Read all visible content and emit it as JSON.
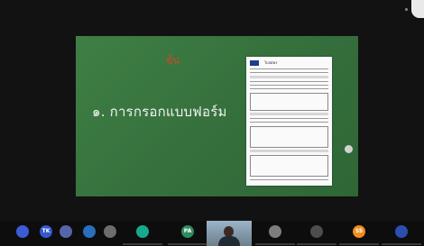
{
  "slide": {
    "handwriting": "ขั้น",
    "heading": "๑. การกรอกแบบฟอร์ม",
    "form_title": "ใบสมัคร"
  },
  "participants": [
    {
      "initials": "",
      "color": "#3d5bd6"
    },
    {
      "initials": "TK",
      "color": "#3557d1"
    },
    {
      "initials": "",
      "color": "#5566a8"
    },
    {
      "initials": "",
      "color": "#2a6fbb"
    },
    {
      "initials": "",
      "color": "#6d6d6d"
    },
    {
      "initials": "",
      "color": "#18a88e"
    },
    {
      "initials": "PA",
      "color": "#2f8a60"
    },
    {
      "initials": "",
      "color": "#7d7d7d"
    },
    {
      "initials": "",
      "color": "#4d4d4d"
    },
    {
      "initials": "",
      "color": "#8f8f8f"
    },
    {
      "initials": "",
      "color": "#5c6d7a"
    },
    {
      "initials": "SS",
      "color": "#f28c1b"
    },
    {
      "initials": "",
      "color": "#2e4db0"
    }
  ]
}
